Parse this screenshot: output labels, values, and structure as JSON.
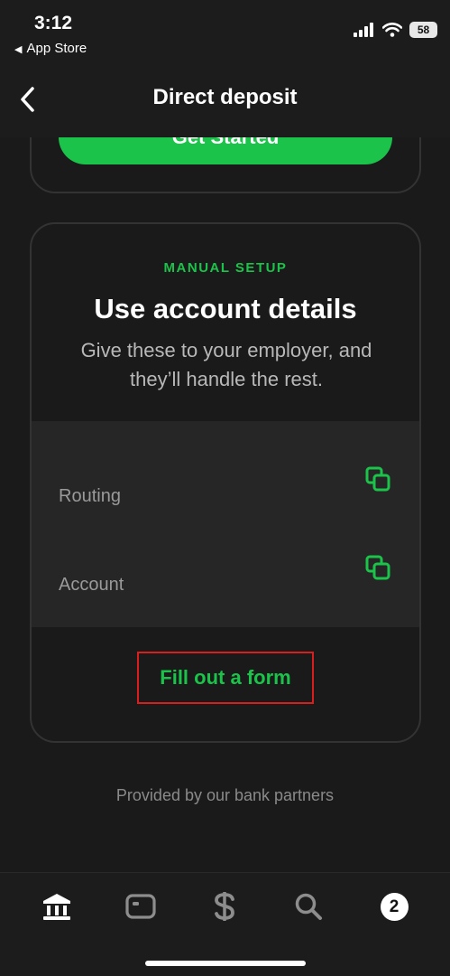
{
  "status": {
    "time": "3:12",
    "back_app": "App Store",
    "battery": "58"
  },
  "nav": {
    "title": "Direct deposit"
  },
  "top_card": {
    "button_label": "Get Started"
  },
  "manual": {
    "label": "MANUAL SETUP",
    "title": "Use account details",
    "description": "Give these to your employer, and they’ll handle the rest.",
    "rows": [
      {
        "label": "Routing"
      },
      {
        "label": "Account"
      }
    ],
    "form_link": "Fill out a form"
  },
  "footer_note": "Provided by our bank partners",
  "tabs": {
    "icons": [
      "bank-icon",
      "card-icon",
      "dollar-icon",
      "search-icon",
      "activity-icon"
    ],
    "activity_badge": "2"
  },
  "colors": {
    "accent": "#1cc34a",
    "background": "#1a1a1a",
    "highlight": "#d91e1e"
  }
}
